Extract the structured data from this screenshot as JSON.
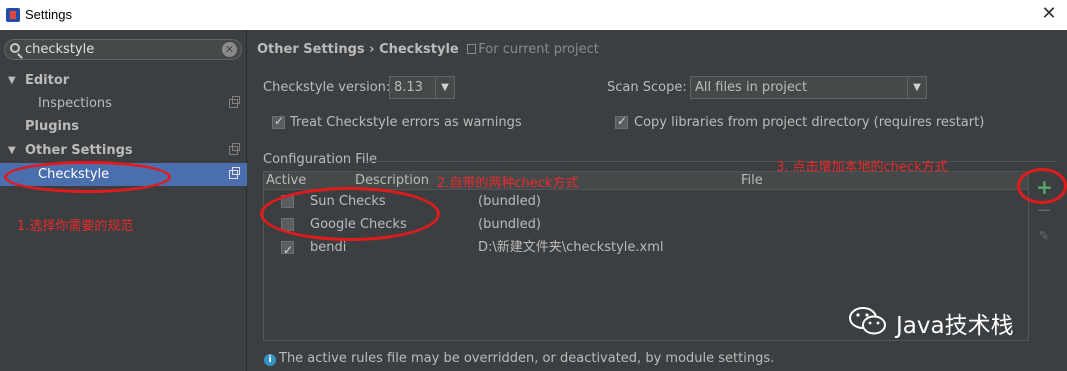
{
  "window": {
    "title": "Settings"
  },
  "search": {
    "value": "checkstyle"
  },
  "sidebar": {
    "items": [
      {
        "label": "Editor",
        "expanded": true
      },
      {
        "label": "Inspections"
      },
      {
        "label": "Plugins"
      },
      {
        "label": "Other Settings",
        "expanded": true
      },
      {
        "label": "Checkstyle",
        "selected": true
      }
    ]
  },
  "breadcrumb": {
    "parent": "Other Settings",
    "separator": "›",
    "current": "Checkstyle",
    "scope_note": "For current project"
  },
  "form": {
    "version_label": "Checkstyle version:",
    "version_value": "8.13",
    "scope_label": "Scan Scope:",
    "scope_value": "All files in project",
    "treat_warnings_label": "Treat Checkstyle errors as warnings",
    "treat_warnings_checked": true,
    "copy_libs_label": "Copy libraries from project directory (requires restart)",
    "copy_libs_checked": true
  },
  "config": {
    "group_title": "Configuration File",
    "columns": {
      "active": "Active",
      "description": "Description",
      "file": "File"
    },
    "rows": [
      {
        "active": false,
        "description": "Sun Checks",
        "file": "(bundled)"
      },
      {
        "active": false,
        "description": "Google Checks",
        "file": "(bundled)"
      },
      {
        "active": true,
        "description": "bendi",
        "file": "D:\\新建文件夹\\checkstyle.xml"
      }
    ],
    "tools": {
      "add": "+",
      "remove": "−",
      "edit": "✎"
    }
  },
  "info_text": "The active rules file may be overridden, or deactivated, by module settings.",
  "annotations": {
    "a1": "1.选择你需要的规范",
    "a2": "2.自带的两种check方式",
    "a3": "3.      点击增加本地的check方式"
  },
  "watermark": {
    "text": "Java技术栈"
  },
  "colors": {
    "selection": "#4b6eaf",
    "annotation": "#e62b2b",
    "add_button": "#59a869",
    "background": "#3c3f41"
  }
}
